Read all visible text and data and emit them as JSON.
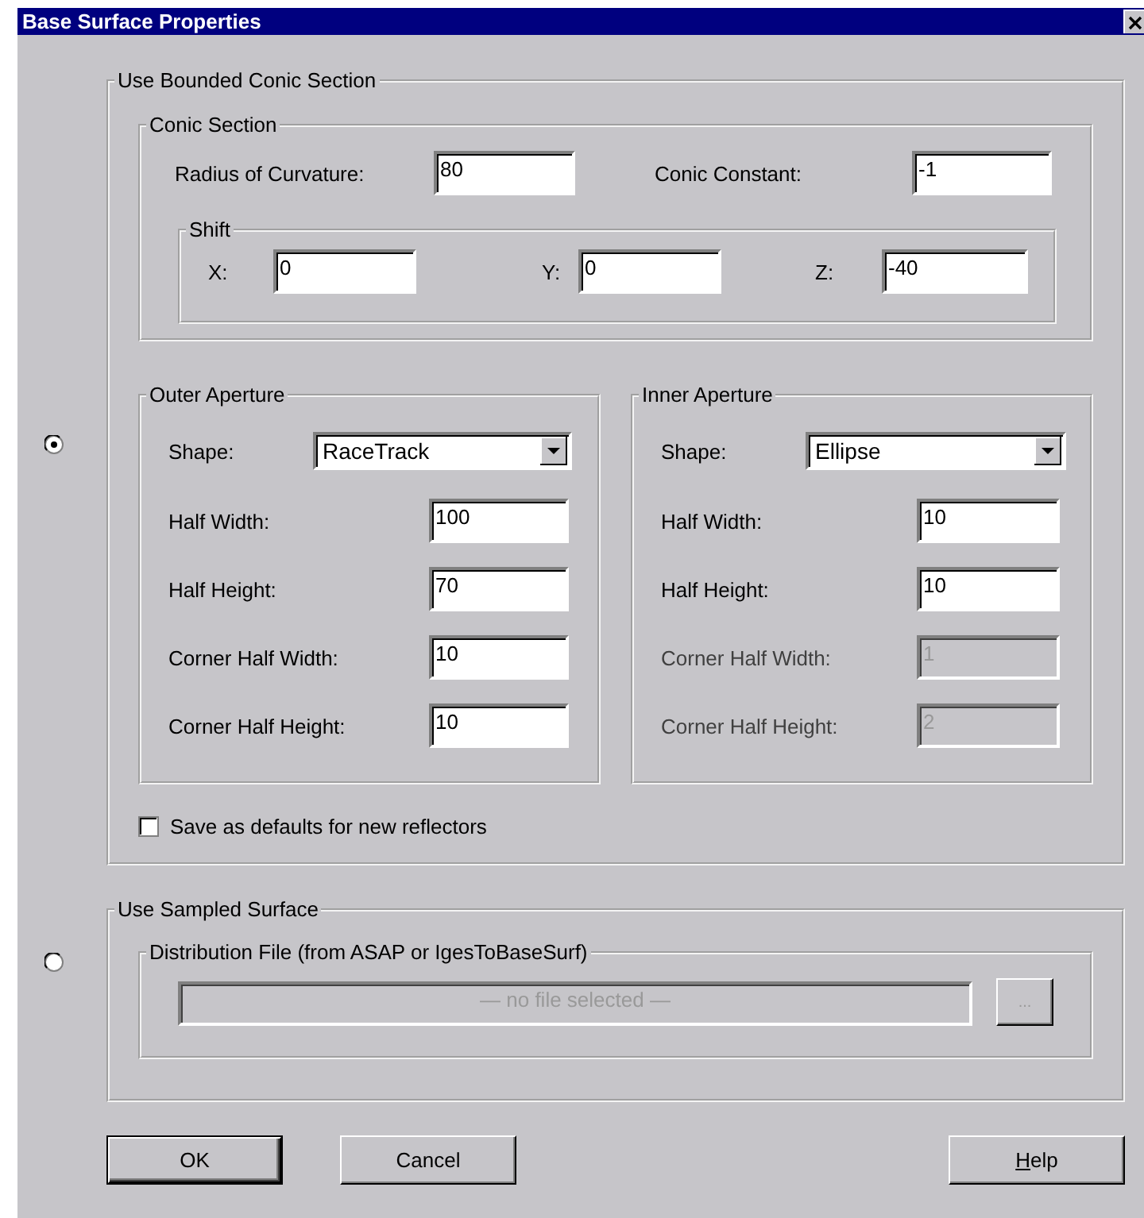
{
  "window": {
    "title": "Base Surface Properties"
  },
  "options": [
    {
      "kind": "conic",
      "selected": true,
      "title": "Use Bounded Conic Section",
      "conic_section": {
        "title": "Conic Section",
        "fields": [
          {
            "label": "Radius of Curvature:",
            "value": "80"
          },
          {
            "label": "Conic Constant:",
            "value": "-1"
          }
        ],
        "shift": {
          "title": "Shift",
          "fields": [
            {
              "label": "X:",
              "value": "0"
            },
            {
              "label": "Y:",
              "value": "0"
            },
            {
              "label": "Z:",
              "value": "-40"
            }
          ]
        }
      },
      "apertures": [
        {
          "title": "Outer Aperture",
          "shape": {
            "label": "Shape:",
            "value": "RaceTrack"
          },
          "fields": [
            {
              "label": "Half Width:",
              "value": "100",
              "disabled": false
            },
            {
              "label": "Half Height:",
              "value": "70",
              "disabled": false
            },
            {
              "label": "Corner Half Width:",
              "value": "10",
              "disabled": false
            },
            {
              "label": "Corner Half Height:",
              "value": "10",
              "disabled": false
            }
          ]
        },
        {
          "title": "Inner Aperture",
          "shape": {
            "label": "Shape:",
            "value": "Ellipse"
          },
          "fields": [
            {
              "label": "Half Width:",
              "value": "10",
              "disabled": false
            },
            {
              "label": "Half Height:",
              "value": "10",
              "disabled": false
            },
            {
              "label": "Corner Half Width:",
              "value": "1",
              "disabled": true
            },
            {
              "label": "Corner Half Height:",
              "value": "2",
              "disabled": true
            }
          ]
        }
      ],
      "save_defaults": {
        "label": "Save as defaults for new reflectors",
        "checked": false
      }
    },
    {
      "kind": "sampled",
      "selected": false,
      "title": "Use Sampled Surface",
      "distribution_file": {
        "title": "Distribution File (from ASAP or IgesToBaseSurf)",
        "placeholder": "— no file selected —",
        "disabled": true,
        "browse_button": {
          "label": "...",
          "disabled": true
        }
      }
    }
  ],
  "buttons": [
    {
      "label": "OK",
      "default": true,
      "access_key_underlined": false
    },
    {
      "label": "Cancel",
      "default": false,
      "access_key_underlined": false
    },
    {
      "label": "Help",
      "default": false,
      "access_key_underlined": true
    }
  ]
}
